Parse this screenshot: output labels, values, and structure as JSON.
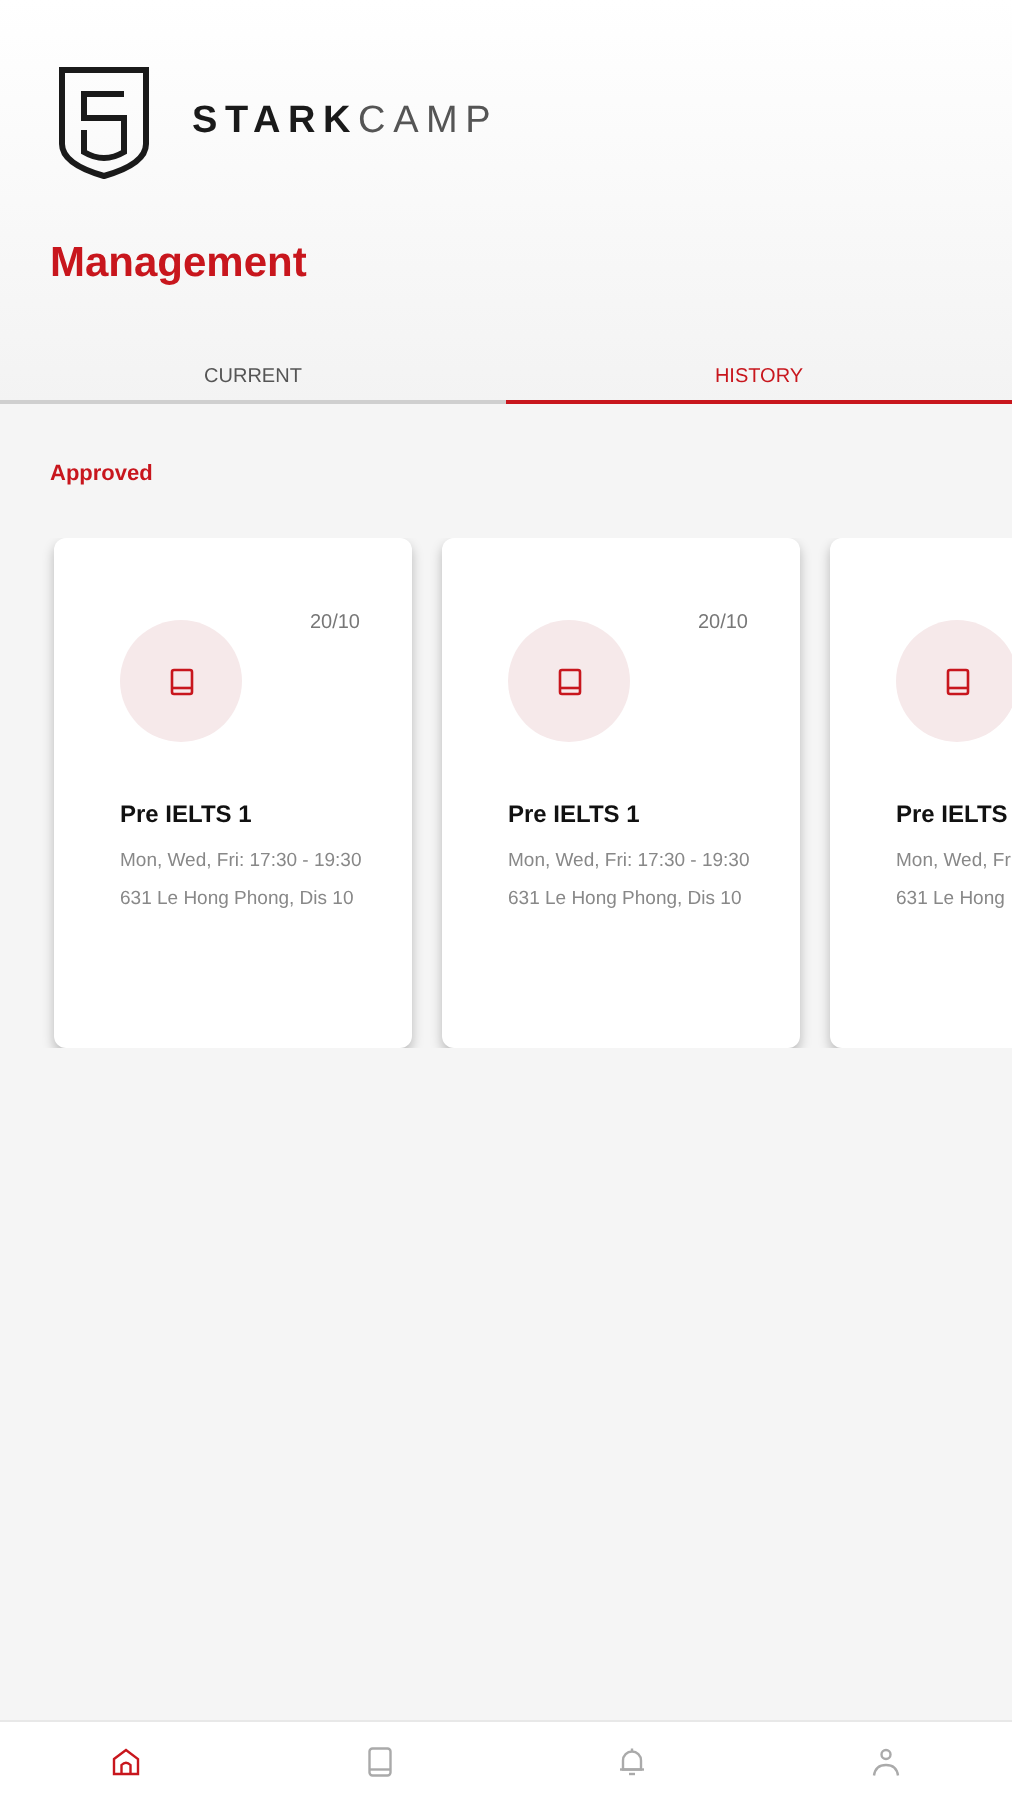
{
  "brand": {
    "bold": "STARK",
    "light": "CAMP"
  },
  "title": "Management",
  "tabs": [
    {
      "label": "CURRENT",
      "selected": false
    },
    {
      "label": "HISTORY",
      "selected": true
    }
  ],
  "section": "Approved",
  "cards": [
    {
      "date": "20/10",
      "name": "Pre IELTS 1",
      "schedule": "Mon, Wed, Fri: 17:30 - 19:30",
      "address": "631 Le Hong Phong, Dis 10"
    },
    {
      "date": "20/10",
      "name": "Pre IELTS 1",
      "schedule": "Mon, Wed, Fri: 17:30 - 19:30",
      "address": "631 Le Hong Phong, Dis 10"
    },
    {
      "name": "Pre IELTS",
      "schedule": "Mon, Wed, Fr",
      "address": "631 Le Hong"
    }
  ],
  "nav": [
    {
      "kind": "home",
      "selected": true
    },
    {
      "kind": "book",
      "selected": false
    },
    {
      "kind": "bell",
      "selected": false
    },
    {
      "kind": "user",
      "selected": false
    }
  ]
}
